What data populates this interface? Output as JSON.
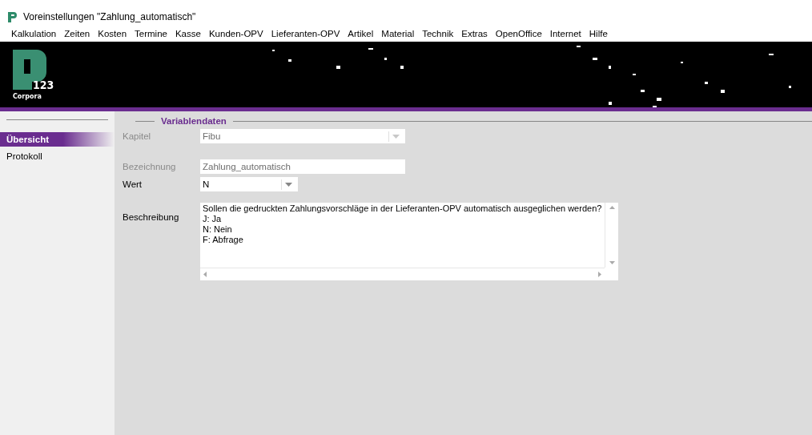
{
  "window": {
    "title": "Voreinstellungen \"Zahlung_automatisch\""
  },
  "menu": [
    "Kalkulation",
    "Zeiten",
    "Kosten",
    "Termine",
    "Kasse",
    "Kunden-OPV",
    "Lieferanten-OPV",
    "Artikel",
    "Material",
    "Technik",
    "Extras",
    "OpenOffice",
    "Internet",
    "Hilfe"
  ],
  "logo": {
    "number": "123",
    "caption": "Corpora"
  },
  "sidebar": {
    "items": [
      {
        "label": "Übersicht",
        "selected": true
      },
      {
        "label": "Protokoll",
        "selected": false
      }
    ]
  },
  "section": {
    "title": "Variablendaten"
  },
  "fields": [
    {
      "kind": "combo",
      "label": "Kapitel",
      "value": "Fibu",
      "disabled": true
    },
    {
      "kind": "text",
      "label": "Bezeichnung",
      "value": "Zahlung_automatisch",
      "disabled": true
    },
    {
      "kind": "combo",
      "label": "Wert",
      "value": "N",
      "disabled": false
    },
    {
      "kind": "memo",
      "label": "Beschreibung",
      "value": "Sollen die gedruckten Zahlungsvorschläge in der Lieferanten-OPV automatisch ausgeglichen werden?\nJ: Ja\nN: Nein\nF: Abfrage",
      "disabled": false
    }
  ]
}
